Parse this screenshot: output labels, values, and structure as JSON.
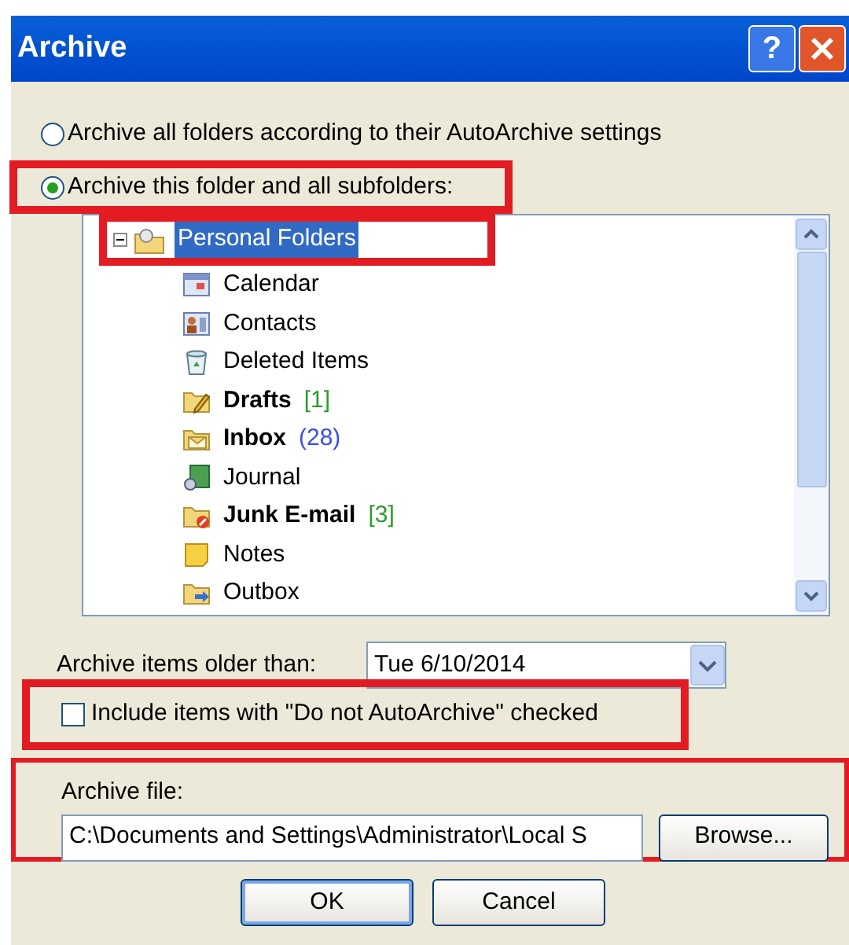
{
  "window": {
    "title": "Archive",
    "help_button": "?"
  },
  "options": [
    {
      "label": "Archive all folders according to their AutoArchive settings",
      "selected": false,
      "highlighted": false
    },
    {
      "label": "Archive this folder and all subfolders:",
      "selected": true,
      "highlighted": true
    }
  ],
  "tree": {
    "root": {
      "label": "Personal Folders",
      "selected": true,
      "highlighted": true,
      "expanded": true,
      "children": [
        {
          "label": "Calendar",
          "kind": "calendar",
          "bold": false
        },
        {
          "label": "Contacts",
          "kind": "contacts",
          "bold": false
        },
        {
          "label": "Deleted Items",
          "kind": "trash",
          "bold": false
        },
        {
          "label": "Drafts",
          "kind": "drafts",
          "bold": true,
          "count": "[1]",
          "color": "#2e9a2e"
        },
        {
          "label": "Inbox",
          "kind": "inbox",
          "bold": true,
          "count": "(28)",
          "color": "#3a4ee8"
        },
        {
          "label": "Journal",
          "kind": "journal",
          "bold": false
        },
        {
          "label": "Junk E-mail",
          "kind": "junk",
          "bold": true,
          "count": "[3]",
          "color": "#2e9a2e"
        },
        {
          "label": "Notes",
          "kind": "notes",
          "bold": false
        },
        {
          "label": "Outbox",
          "kind": "outbox",
          "bold": false
        }
      ]
    }
  },
  "older_than": {
    "label": "Archive items older than:",
    "value": "Tue 6/10/2014"
  },
  "include_option": {
    "label": "Include items with \"Do not AutoArchive\" checked",
    "checked": false,
    "highlighted": true
  },
  "archive_file": {
    "label": "Archive file:",
    "value": "C:\\Documents and Settings\\Administrator\\Local S",
    "browse": "Browse...",
    "highlighted": true
  },
  "buttons": [
    {
      "label": "OK",
      "default": true
    },
    {
      "label": "Cancel",
      "default": false
    }
  ]
}
